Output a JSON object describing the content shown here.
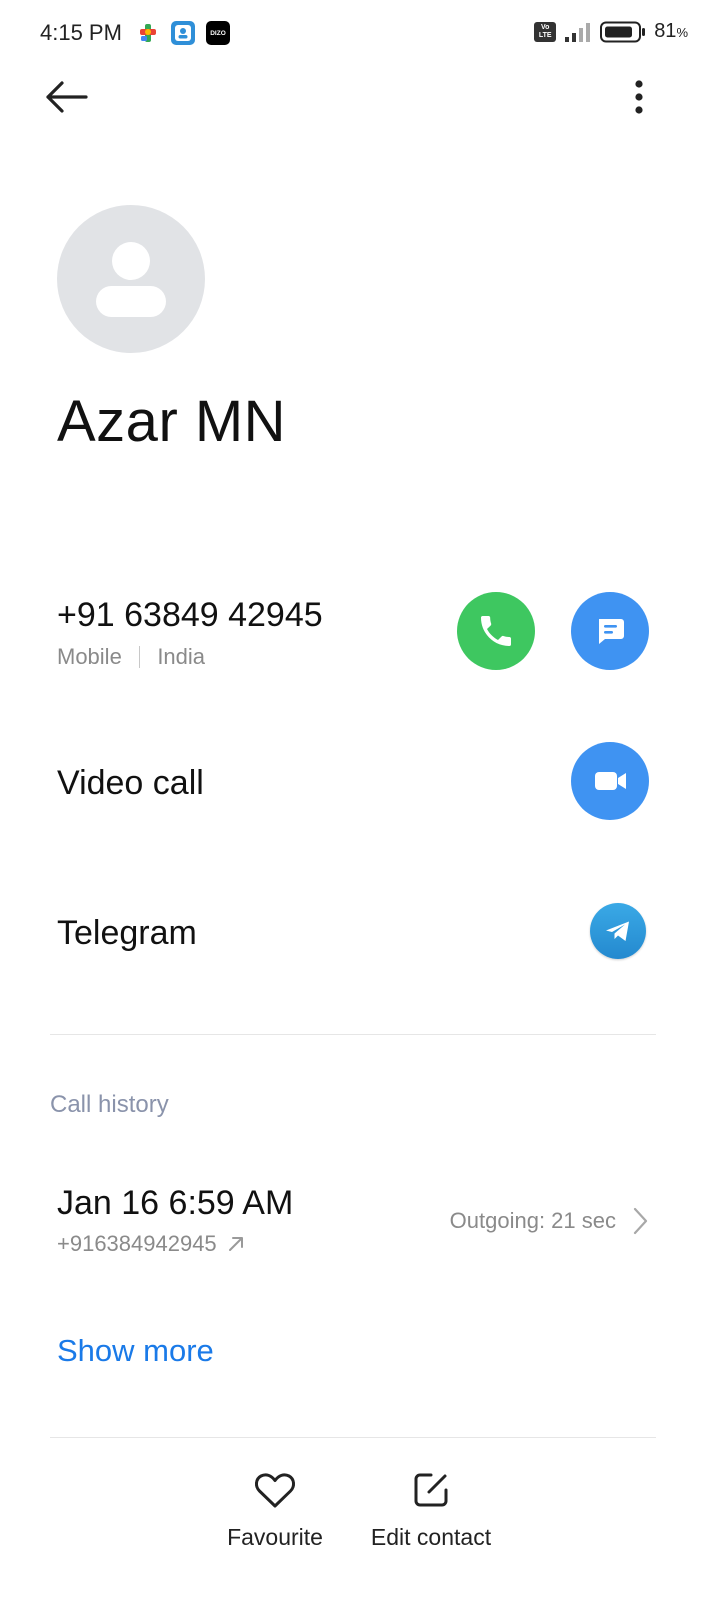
{
  "status_bar": {
    "time": "4:15 PM",
    "battery_percent": "81",
    "battery_symbol": "%",
    "notification_icons": [
      "google-play-games-icon",
      "contacts-app-icon",
      "dizo-app-icon"
    ],
    "dizo_label": "DIZO",
    "volte_label": "Vo LTE"
  },
  "header": {
    "back_icon": "arrow-left-icon",
    "more_icon": "more-vertical-icon"
  },
  "contact": {
    "name": "Azar MN",
    "phone": "+91 63849 42945",
    "phone_type": "Mobile",
    "phone_region": "India"
  },
  "actions": {
    "video_call_label": "Video call",
    "telegram_label": "Telegram"
  },
  "call_history": {
    "title": "Call history",
    "entries": [
      {
        "date": "Jan 16 6:59 AM",
        "number": "+916384942945",
        "duration": "Outgoing: 21 sec"
      }
    ],
    "show_more": "Show more"
  },
  "bottom_bar": {
    "favourite_label": "Favourite",
    "edit_label": "Edit contact"
  },
  "colors": {
    "call_green": "#3ec760",
    "action_blue": "#3f93f2",
    "link_blue": "#1a7ae8",
    "telegram_blue": "#2a9ad9",
    "avatar_bg": "#e1e3e6"
  }
}
